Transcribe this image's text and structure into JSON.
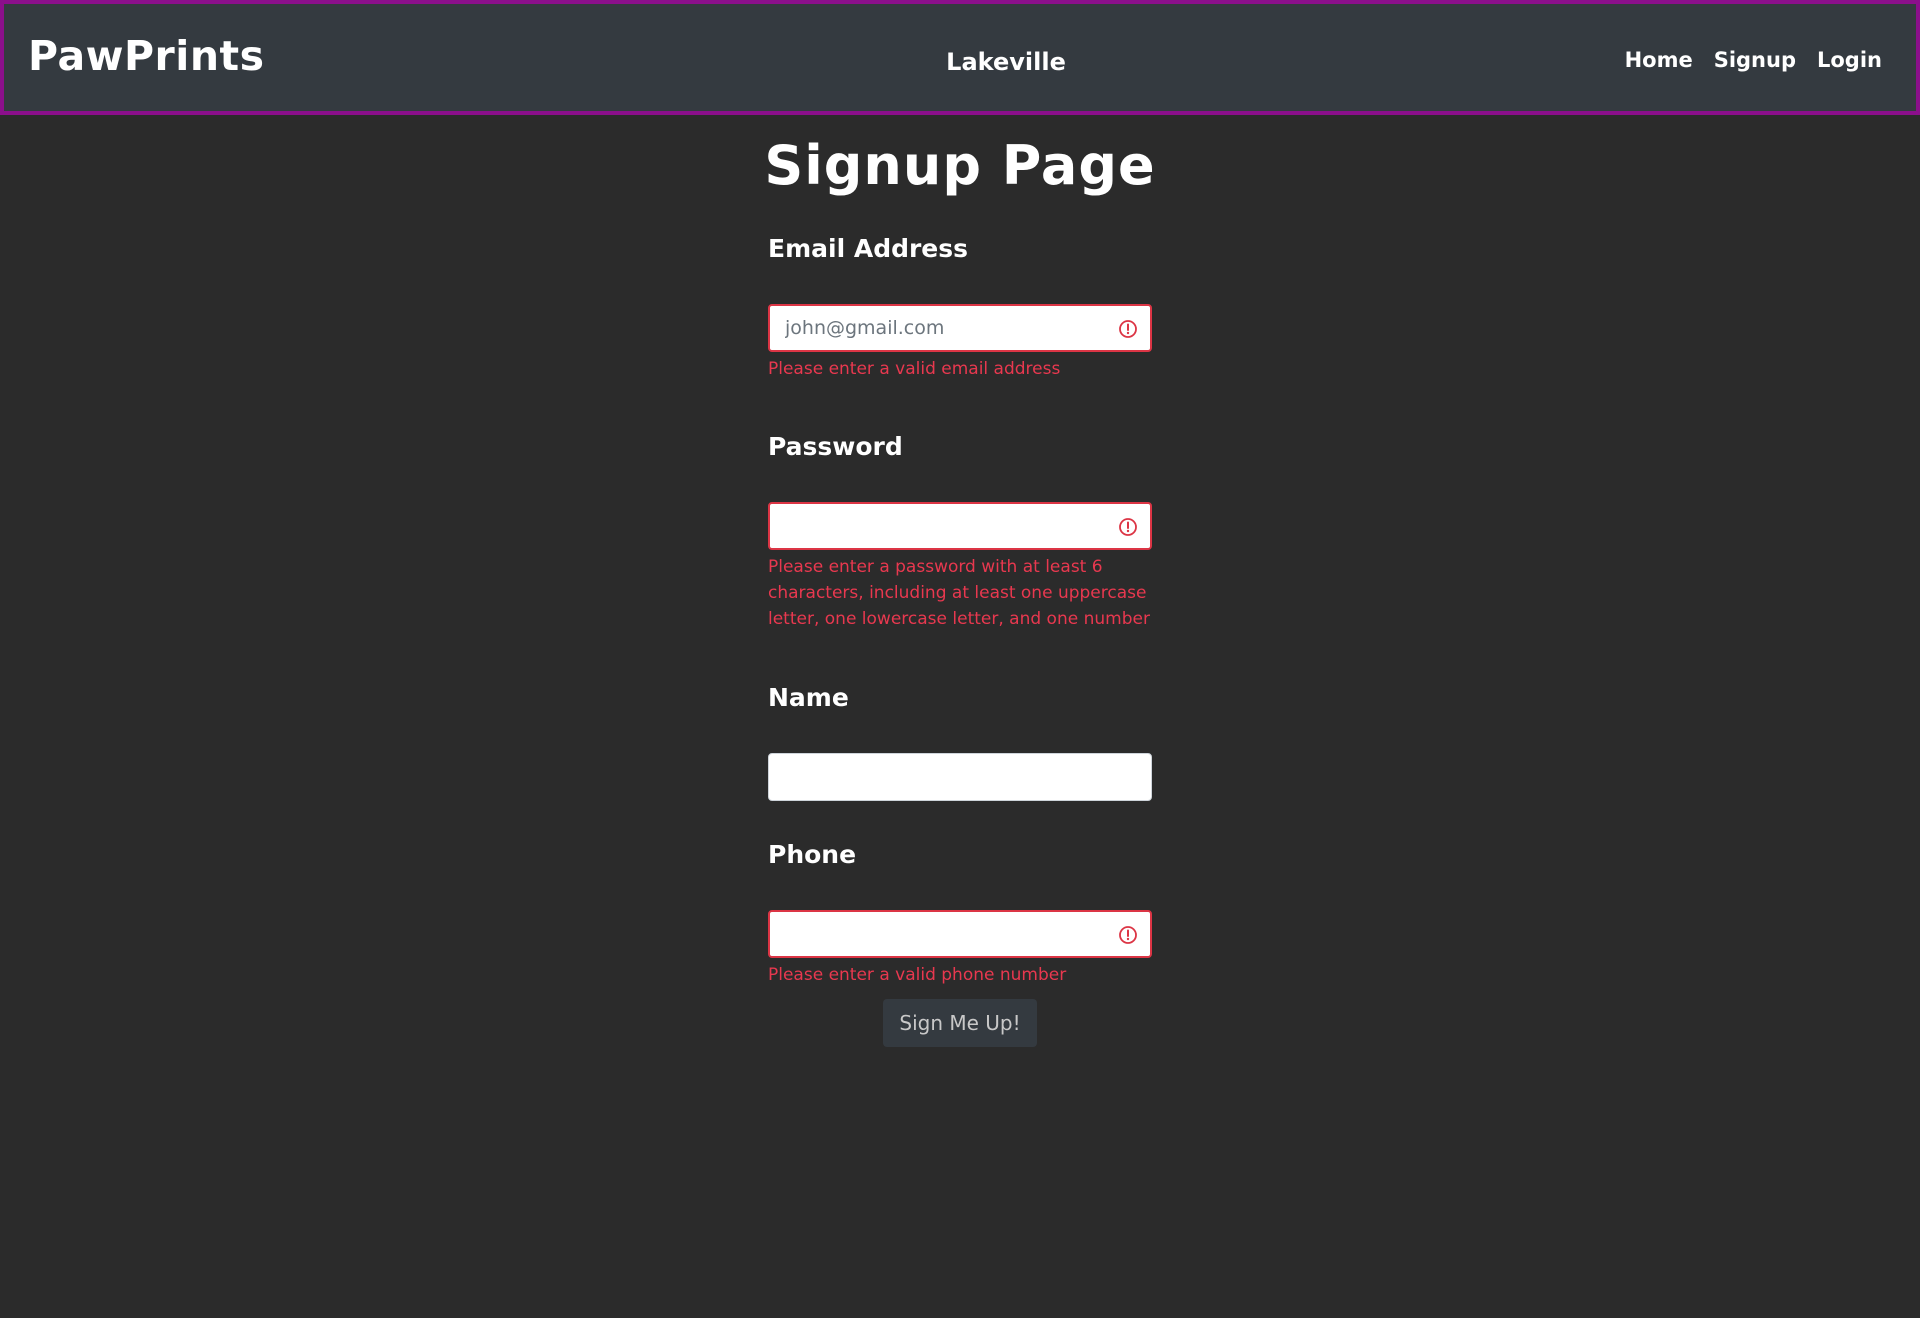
{
  "navbar": {
    "brand": "PawPrints",
    "location": "Lakeville",
    "links": [
      {
        "label": "Home"
      },
      {
        "label": "Signup"
      },
      {
        "label": "Login"
      }
    ]
  },
  "page": {
    "title": "Signup Page"
  },
  "form": {
    "email": {
      "label": "Email Address",
      "placeholder": "john@gmail.com",
      "value": "",
      "error": "Please enter a valid email address"
    },
    "password": {
      "label": "Password",
      "value": "",
      "error": "Please enter a password with at least 6 characters, including at least one uppercase letter, one lowercase letter, and one number"
    },
    "name": {
      "label": "Name",
      "value": ""
    },
    "phone": {
      "label": "Phone",
      "value": "",
      "error": "Please enter a valid phone number"
    },
    "submit_label": "Sign Me Up!"
  },
  "icons": {
    "invalid": "exclamation-circle-icon"
  },
  "colors": {
    "navbar_bg": "#343a40",
    "navbar_border": "#8b0f8b",
    "page_bg": "#2b2b2b",
    "error": "#dc3545",
    "button_bg": "#343a40"
  }
}
